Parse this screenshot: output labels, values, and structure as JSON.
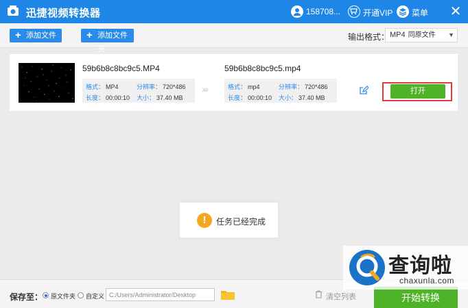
{
  "window": {
    "title": "迅捷视频转换器",
    "user": "158708...",
    "vip_label": "开通VIP",
    "menu_label": "菜单",
    "close_glyph": "✕"
  },
  "toolbar": {
    "add_file": "添加文件",
    "add_folder": "添加文件夹",
    "plus_glyph": "+",
    "output_format_label": "输出格式：",
    "format_value": "MP4",
    "format_quality": "同原文件",
    "dropdown_glyph": "▼"
  },
  "file": {
    "source": {
      "name": "59b6b8c8bc9c5.MP4",
      "format_key": "格式：",
      "format": "MP4",
      "resolution_key": "分辨率：",
      "resolution": "720*486",
      "duration_key": "长度：",
      "duration": "00:00:10",
      "size_key": "大小：",
      "size": "37.40 MB"
    },
    "target": {
      "name": "59b6b8c8bc9c5.mp4",
      "format_key": "格式：",
      "format": "mp4",
      "resolution_key": "分辨率：",
      "resolution": "720*486",
      "duration_key": "长度：",
      "duration": "00:00:10",
      "size_key": "大小：",
      "size": "37.40 MB"
    },
    "arrow_glyph": "›››",
    "open_button": "打开"
  },
  "toast": {
    "icon_glyph": "!",
    "message": "任务已经完成"
  },
  "bottom": {
    "save_to_label": "保存至：",
    "option_original": "原文件夹",
    "option_custom": "自定义",
    "path": "C:/Users/Administrator/Desktop",
    "clear_list": "清空列表",
    "start_button": "开始转换"
  },
  "watermark": {
    "chinese": "查询啦",
    "english": "chaxunla.com"
  },
  "colors": {
    "titlebar": "#1d86e6",
    "primary_button": "#2a8ce8",
    "success_green": "#4fb32a",
    "highlight_red": "#e23b3b",
    "warning_orange": "#f5a623"
  }
}
